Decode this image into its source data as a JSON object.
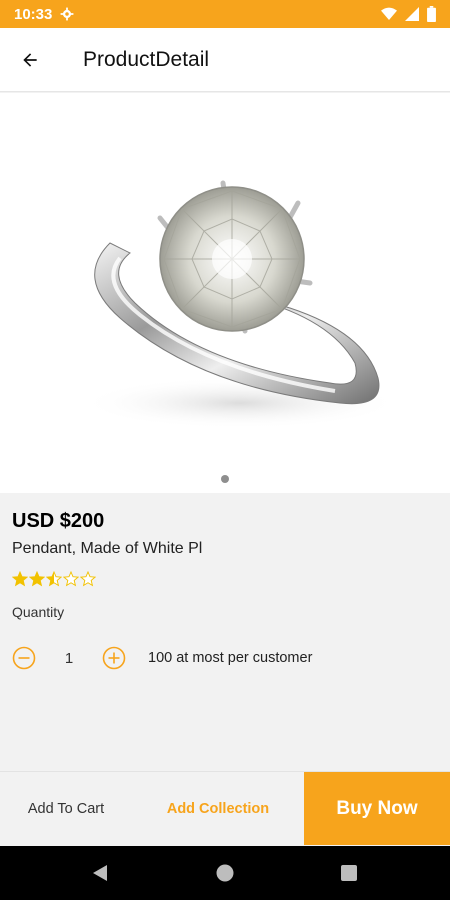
{
  "status_bar": {
    "time": "10:33"
  },
  "app_bar": {
    "title": "ProductDetail"
  },
  "product": {
    "price": "USD $200",
    "description": "Pendant, Made of White Pl",
    "rating": 2.5,
    "rating_max": 5,
    "image_page_count": 1
  },
  "quantity": {
    "label": "Quantity",
    "value": "1",
    "note": "100 at most per customer"
  },
  "actions": {
    "add_to_cart": "Add To Cart",
    "add_collection": "Add Collection",
    "buy_now": "Buy Now"
  },
  "colors": {
    "accent": "#f7a41c",
    "star": "#f2c200"
  }
}
